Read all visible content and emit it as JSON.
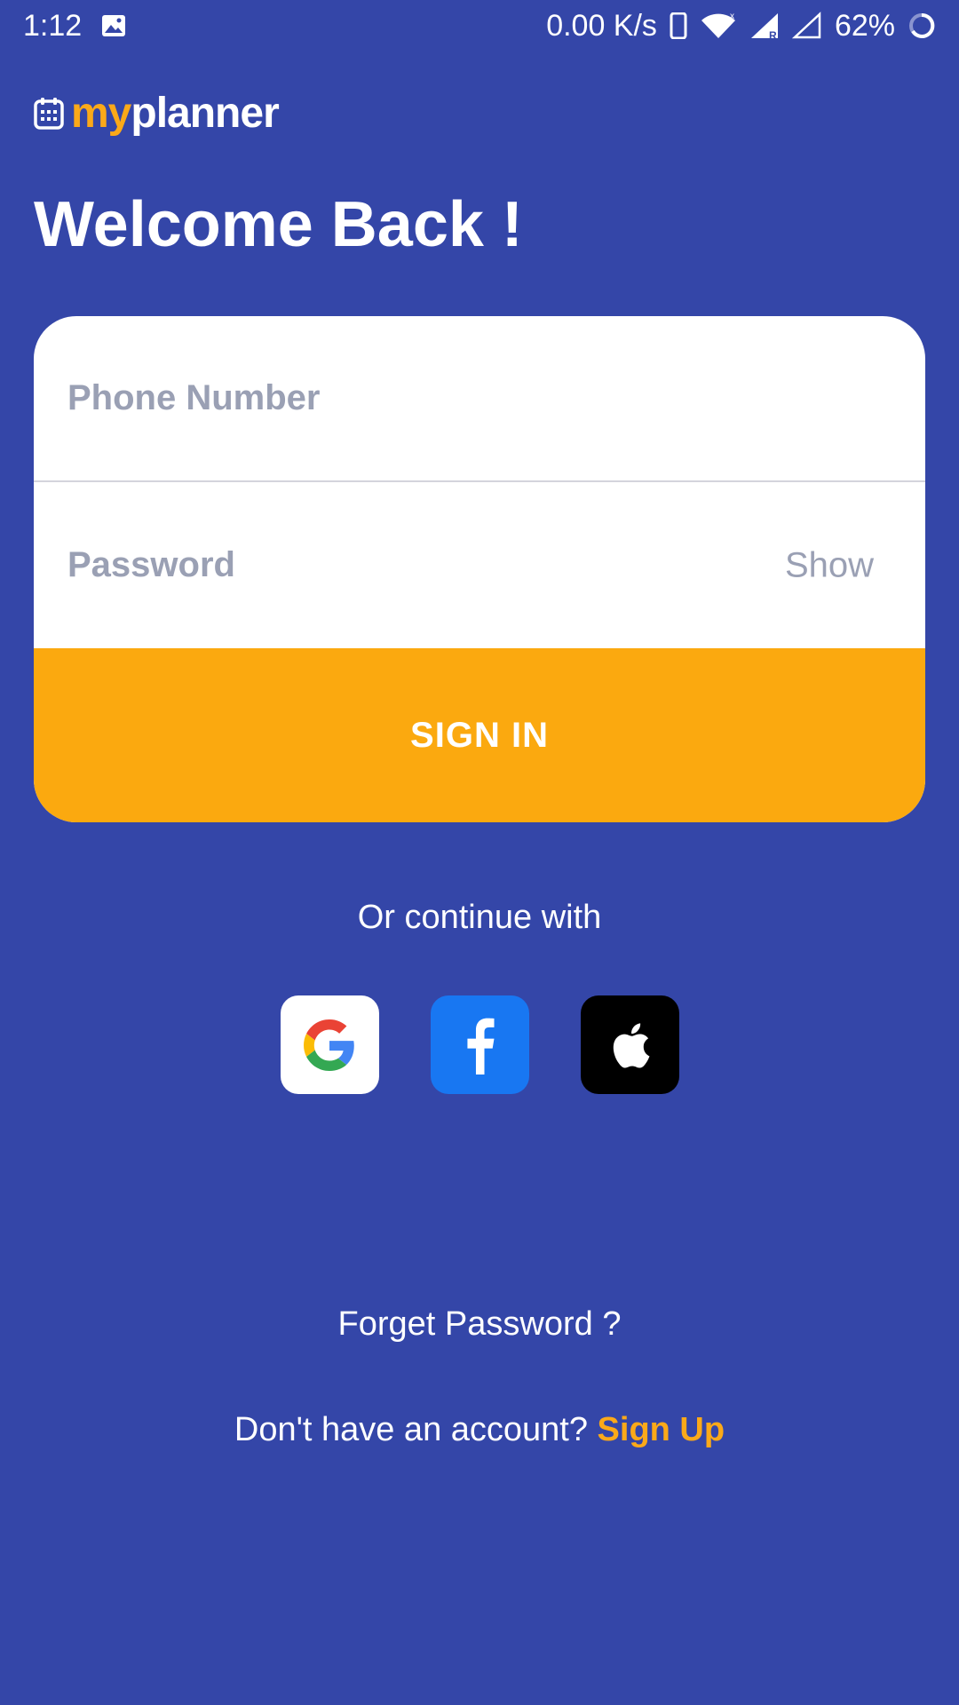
{
  "status_bar": {
    "time": "1:12",
    "net_speed": "0.00 K/s",
    "battery": "62%",
    "icons": [
      "image-icon",
      "phone-icon",
      "wifi-icon",
      "signal-icon",
      "signal-empty-icon",
      "battery-ring-icon"
    ]
  },
  "logo": {
    "part1": "my",
    "part2": "planner",
    "icon": "calendar-icon"
  },
  "heading": "Welcome Back !",
  "form": {
    "phone_placeholder": "Phone Number",
    "password_placeholder": "Password",
    "show_label": "Show",
    "signin_label": "SIGN IN"
  },
  "alt_login": {
    "label": "Or continue with",
    "providers": [
      "google-icon",
      "facebook-icon",
      "apple-icon"
    ]
  },
  "footer": {
    "forget": "Forget Password ?",
    "no_account": "Don't have an account? ",
    "signup": "Sign Up"
  },
  "colors": {
    "background": "#3446a8",
    "accent": "#fba919",
    "facebook": "#1877f2"
  }
}
